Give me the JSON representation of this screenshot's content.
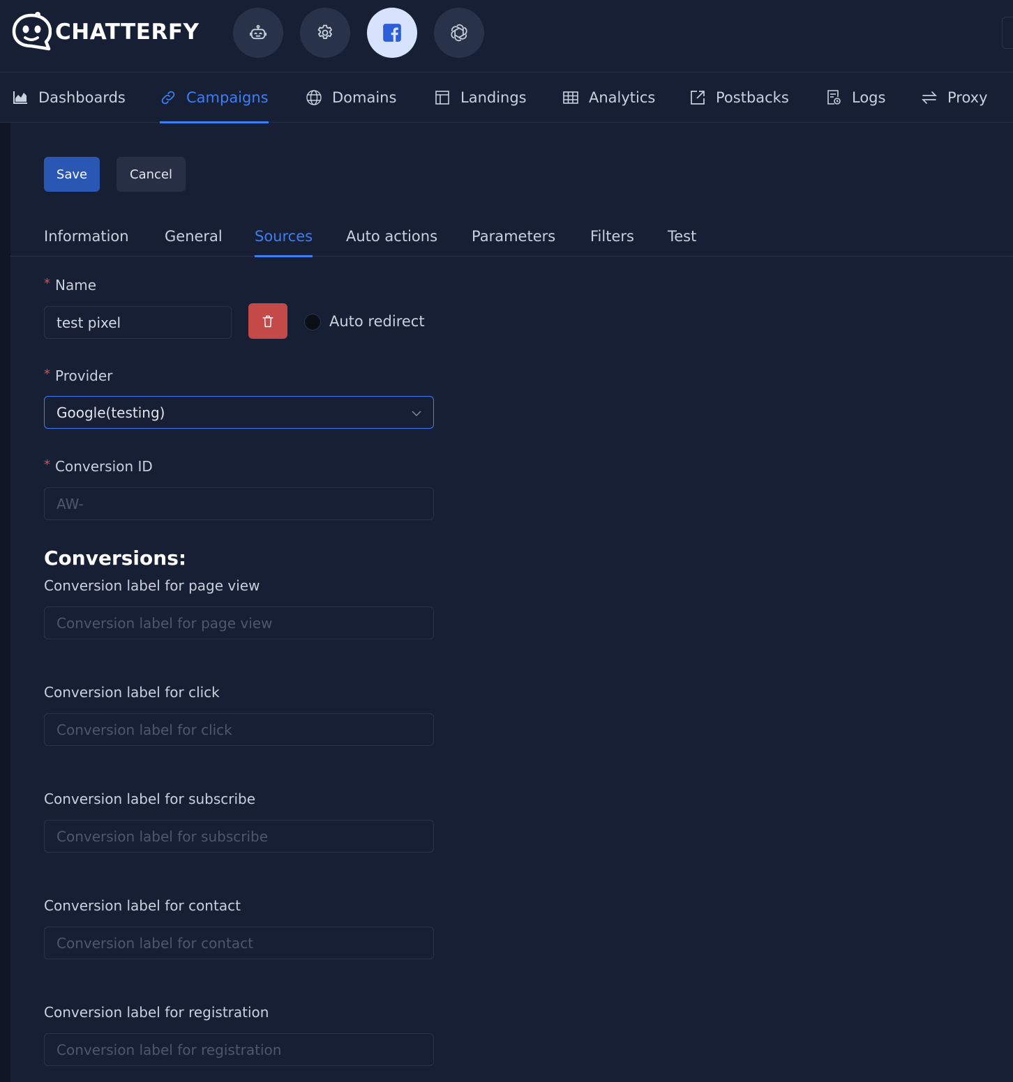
{
  "brand": {
    "name": "CHATTERFY"
  },
  "top_icons": [
    {
      "name": "bot-icon",
      "active": false
    },
    {
      "name": "settings-icon",
      "active": false
    },
    {
      "name": "facebook-icon",
      "active": true
    },
    {
      "name": "openai-icon",
      "active": false
    }
  ],
  "nav": {
    "items": [
      {
        "label": "Dashboards",
        "icon": "chart-icon"
      },
      {
        "label": "Campaigns",
        "icon": "link-icon",
        "active": true
      },
      {
        "label": "Domains",
        "icon": "globe-icon"
      },
      {
        "label": "Landings",
        "icon": "layout-icon"
      },
      {
        "label": "Analytics",
        "icon": "table-icon"
      },
      {
        "label": "Postbacks",
        "icon": "external-link-icon"
      },
      {
        "label": "Logs",
        "icon": "log-file-icon"
      },
      {
        "label": "Proxy",
        "icon": "swap-icon"
      }
    ]
  },
  "actions": {
    "save": "Save",
    "cancel": "Cancel"
  },
  "tabs": [
    "Information",
    "General",
    "Sources",
    "Auto actions",
    "Parameters",
    "Filters",
    "Test"
  ],
  "active_tab": "Sources",
  "form": {
    "name_label": "Name",
    "name_value": "test pixel",
    "auto_redirect_label": "Auto redirect",
    "provider_label": "Provider",
    "provider_value": "Google(testing)",
    "conversion_id_label": "Conversion ID",
    "conversion_id_placeholder": "AW-",
    "conversions_title": "Conversions:",
    "conversions": [
      {
        "label": "Conversion label for page view",
        "placeholder": "Conversion label for page view"
      },
      {
        "label": "Conversion label for click",
        "placeholder": "Conversion label for click"
      },
      {
        "label": "Conversion label for subscribe",
        "placeholder": "Conversion label for subscribe"
      },
      {
        "label": "Conversion label for contact",
        "placeholder": "Conversion label for contact"
      },
      {
        "label": "Conversion label for registration",
        "placeholder": "Conversion label for registration"
      }
    ]
  },
  "colors": {
    "background": "#161f33",
    "accent": "#3f7df5",
    "save_button": "#2a56b4",
    "delete_button": "#c34a48",
    "required": "#d9534f"
  }
}
